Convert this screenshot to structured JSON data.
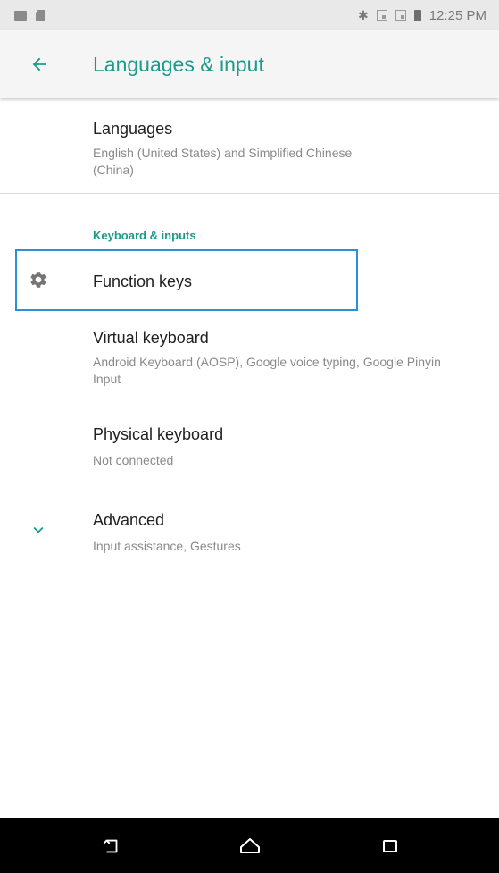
{
  "status_bar": {
    "time": "12:25 PM",
    "icons": [
      "image-icon",
      "sd-card-icon",
      "bluetooth-icon",
      "signal-icon",
      "signal-icon",
      "battery-icon"
    ]
  },
  "app_bar": {
    "title": "Languages & input",
    "back_icon": "arrow-back-icon",
    "accent": "#1c9b8a"
  },
  "list": {
    "languages": {
      "title": "Languages",
      "subtitle": "English (United States) and Simplified Chinese (China)"
    },
    "section_header": "Keyboard & inputs",
    "function_keys": {
      "title": "Function keys",
      "icon": "gear-icon"
    },
    "virtual_keyboard": {
      "title": "Virtual keyboard",
      "subtitle": "Android Keyboard (AOSP), Google voice typing, Google Pinyin Input"
    },
    "physical_keyboard": {
      "title": "Physical keyboard",
      "subtitle": "Not connected"
    },
    "advanced": {
      "title": "Advanced",
      "subtitle": "Input assistance, Gestures",
      "icon": "chevron-down-icon"
    }
  },
  "nav_bar": {
    "icons": [
      "back-nav-icon",
      "home-icon",
      "recents-icon"
    ]
  },
  "colors": {
    "accent": "#1c9b8a",
    "highlight": "#2d8fd6",
    "nav_bar": "#000000"
  }
}
